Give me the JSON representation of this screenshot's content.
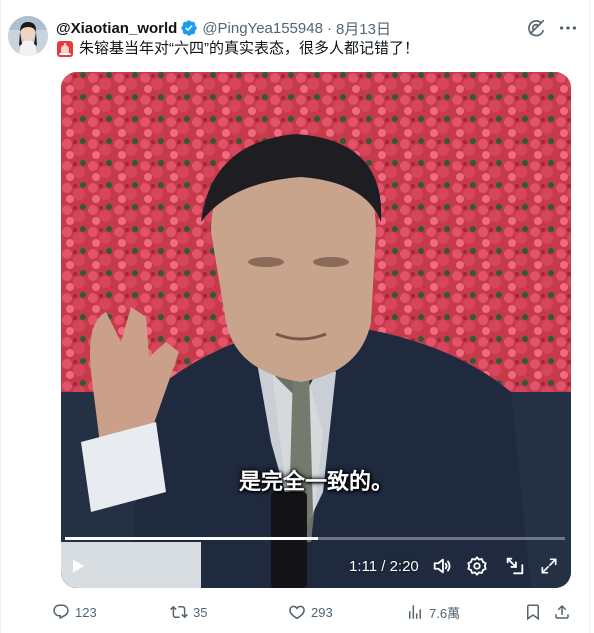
{
  "author": {
    "display_name": "@Xiaotian_world",
    "handle": "@PingYea155948",
    "separator": "·",
    "date": "8月13日",
    "verified_color": "#1d9bf0"
  },
  "tweet": {
    "text": "朱镕基当年对“六四”的真实表态，很多人都记错了！",
    "lead_emoji_icon": "siren-icon"
  },
  "video": {
    "caption": "是完全一致的。",
    "time_display": "1:11 / 2:20",
    "progress": 0.505,
    "controls": [
      "play-icon",
      "volume-icon",
      "settings-icon",
      "pop-out-icon",
      "fullscreen-icon"
    ]
  },
  "actions": {
    "reply_count": "123",
    "repost_count": "35",
    "like_count": "293",
    "view_count": "7.6萬"
  },
  "colors": {
    "text_primary": "#0f1419",
    "text_secondary": "#536471",
    "accent": "#1d9bf0"
  }
}
